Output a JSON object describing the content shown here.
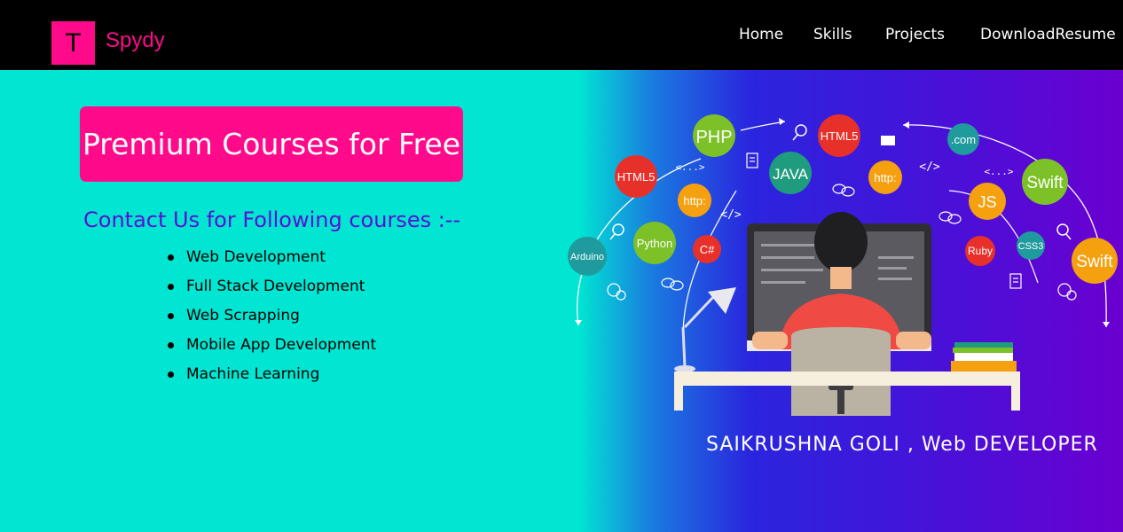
{
  "navbar": {
    "logo_letter": "T",
    "brand": "Spydy",
    "links": [
      "Home",
      "Skills",
      "Projects",
      "DownloadResume"
    ]
  },
  "promo": {
    "title": "Premium Courses for Free"
  },
  "contact": {
    "heading": "Contact Us for Following courses :--",
    "courses": [
      "Web Development",
      "Full Stack Development",
      "Web Scrapping",
      "Mobile App Development",
      "Machine Learning"
    ]
  },
  "hero": {
    "tagline": "SAIKRUSHNA GOLI , Web DEVELOPER",
    "tech_badges": [
      "PHP",
      "HTML5",
      "JAVA",
      "HTML5",
      "http:",
      ".com",
      "Swift",
      "http:",
      "JS",
      "Arduino",
      "Python",
      "C#",
      "Ruby",
      "CSS3",
      "Swift"
    ],
    "code_tags": [
      "<...>",
      "</>",
      "</>",
      "<...>"
    ]
  },
  "colors": {
    "accent": "#ff0a8a",
    "left_bg": "#00e6d2",
    "heading": "#5a10d2",
    "hero_end": "#6a00d0"
  }
}
